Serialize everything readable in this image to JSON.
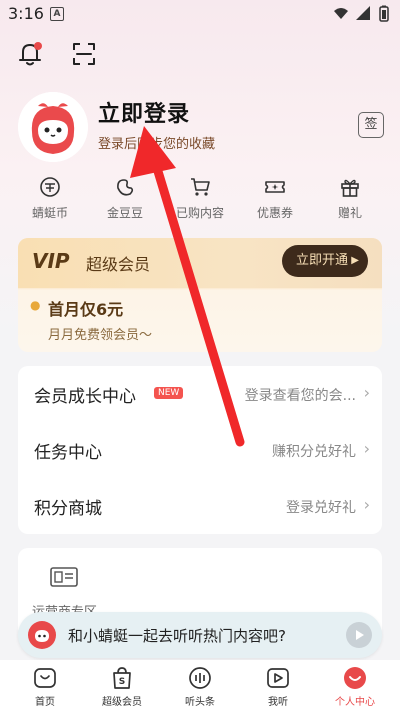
{
  "status_bar": {
    "time": "3:16",
    "badge": "A"
  },
  "profile": {
    "title": "立即登录",
    "subtitle": "登录后同步您的收藏",
    "sign_label": "签"
  },
  "quick_items": [
    {
      "label": "蜻蜓币",
      "icon": "coin-icon"
    },
    {
      "label": "金豆豆",
      "icon": "bean-icon"
    },
    {
      "label": "已购内容",
      "icon": "cart-icon"
    },
    {
      "label": "优惠券",
      "icon": "ticket-icon"
    },
    {
      "label": "赠礼",
      "icon": "gift-icon"
    }
  ],
  "vip": {
    "logo": "VIP",
    "title": "超级会员",
    "button": "立即开通",
    "offer": "首月仅6元",
    "offer_sub": "月月免费领会员～"
  },
  "list": [
    {
      "title": "会员成长中心",
      "badge": "NEW",
      "right": "登录查看您的会..."
    },
    {
      "title": "任务中心",
      "right": "赚积分兑好礼"
    },
    {
      "title": "积分商城",
      "right": "登录兑好礼"
    }
  ],
  "ops": {
    "label": "运营商专区"
  },
  "tip": {
    "text": "和小蜻蜓一起去听听热门内容吧?"
  },
  "nav": [
    {
      "label": "首页",
      "icon": "home-icon"
    },
    {
      "label": "超级会员",
      "icon": "vip-bag-icon"
    },
    {
      "label": "听头条",
      "icon": "waveform-icon"
    },
    {
      "label": "我听",
      "icon": "play-box-icon"
    },
    {
      "label": "个人中心",
      "icon": "profile-icon"
    }
  ],
  "colors": {
    "accent": "#e8494a",
    "arrow": "#f0282a",
    "vip_dark": "#3d2a1b"
  }
}
